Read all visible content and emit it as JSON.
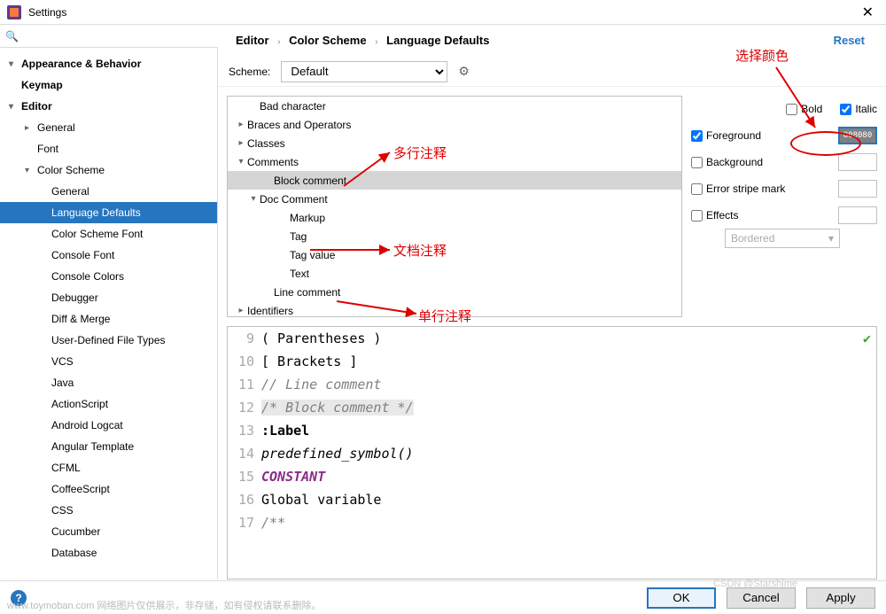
{
  "window": {
    "title": "Settings"
  },
  "breadcrumb": [
    "Editor",
    "Color Scheme",
    "Language Defaults"
  ],
  "reset_label": "Reset",
  "scheme": {
    "label": "Scheme:",
    "value": "Default"
  },
  "sidebar": [
    {
      "label": "Appearance & Behavior",
      "level": 1,
      "chev": "v",
      "bold": true
    },
    {
      "label": "Keymap",
      "level": 1,
      "chev": "",
      "bold": true
    },
    {
      "label": "Editor",
      "level": 1,
      "chev": "v",
      "bold": true
    },
    {
      "label": "General",
      "level": 2,
      "chev": ">",
      "bold": false
    },
    {
      "label": "Font",
      "level": 2,
      "chev": "",
      "bold": false
    },
    {
      "label": "Color Scheme",
      "level": 2,
      "chev": "v",
      "bold": false
    },
    {
      "label": "General",
      "level": 3,
      "chev": "",
      "bold": false
    },
    {
      "label": "Language Defaults",
      "level": 3,
      "chev": "",
      "bold": false,
      "selected": true
    },
    {
      "label": "Color Scheme Font",
      "level": 3,
      "chev": "",
      "bold": false
    },
    {
      "label": "Console Font",
      "level": 3,
      "chev": "",
      "bold": false
    },
    {
      "label": "Console Colors",
      "level": 3,
      "chev": "",
      "bold": false
    },
    {
      "label": "Debugger",
      "level": 3,
      "chev": "",
      "bold": false
    },
    {
      "label": "Diff & Merge",
      "level": 3,
      "chev": "",
      "bold": false
    },
    {
      "label": "User-Defined File Types",
      "level": 3,
      "chev": "",
      "bold": false
    },
    {
      "label": "VCS",
      "level": 3,
      "chev": "",
      "bold": false
    },
    {
      "label": "Java",
      "level": 3,
      "chev": "",
      "bold": false
    },
    {
      "label": "ActionScript",
      "level": 3,
      "chev": "",
      "bold": false
    },
    {
      "label": "Android Logcat",
      "level": 3,
      "chev": "",
      "bold": false
    },
    {
      "label": "Angular Template",
      "level": 3,
      "chev": "",
      "bold": false
    },
    {
      "label": "CFML",
      "level": 3,
      "chev": "",
      "bold": false
    },
    {
      "label": "CoffeeScript",
      "level": 3,
      "chev": "",
      "bold": false
    },
    {
      "label": "CSS",
      "level": 3,
      "chev": "",
      "bold": false
    },
    {
      "label": "Cucumber",
      "level": 3,
      "chev": "",
      "bold": false
    },
    {
      "label": "Database",
      "level": 3,
      "chev": "",
      "bold": false
    }
  ],
  "color_tree": [
    {
      "label": "Bad character",
      "level": 1,
      "chev": ""
    },
    {
      "label": "Braces and Operators",
      "level": 0,
      "chev": ">"
    },
    {
      "label": "Classes",
      "level": 0,
      "chev": ">"
    },
    {
      "label": "Comments",
      "level": 0,
      "chev": "v"
    },
    {
      "label": "Block comment",
      "level": 2,
      "chev": "",
      "selected": true
    },
    {
      "label": "Doc Comment",
      "level": 1,
      "chev": "v"
    },
    {
      "label": "Markup",
      "level": 3,
      "chev": ""
    },
    {
      "label": "Tag",
      "level": 3,
      "chev": ""
    },
    {
      "label": "Tag value",
      "level": 3,
      "chev": ""
    },
    {
      "label": "Text",
      "level": 3,
      "chev": ""
    },
    {
      "label": "Line comment",
      "level": 2,
      "chev": ""
    },
    {
      "label": "Identifiers",
      "level": 0,
      "chev": ">"
    }
  ],
  "options": {
    "bold": {
      "label": "Bold",
      "checked": false
    },
    "italic": {
      "label": "Italic",
      "checked": true
    },
    "foreground": {
      "label": "Foreground",
      "checked": true,
      "color": "808080"
    },
    "background": {
      "label": "Background",
      "checked": false
    },
    "errorstripe": {
      "label": "Error stripe mark",
      "checked": false
    },
    "effects": {
      "label": "Effects",
      "checked": false,
      "type": "Bordered"
    }
  },
  "preview": [
    {
      "n": 9,
      "txt": "( Parentheses )"
    },
    {
      "n": 10,
      "txt": "[ Brackets ]"
    },
    {
      "n": 11,
      "txt": "// Line comment",
      "cls": "italic gray"
    },
    {
      "n": 12,
      "txt": "/* Block comment */",
      "cls": "italic gray blockcm"
    },
    {
      "n": 13,
      "txt": ":Label",
      "cls": "label-kw"
    },
    {
      "n": 14,
      "txt": "predefined_symbol()",
      "cls": "italic"
    },
    {
      "n": 15,
      "txt": "CONSTANT",
      "cls": "constant"
    },
    {
      "n": 16,
      "txt": "Global variable"
    },
    {
      "n": 17,
      "txt": "/**",
      "cls": "italic gray"
    }
  ],
  "buttons": {
    "ok": "OK",
    "cancel": "Cancel",
    "apply": "Apply"
  },
  "annotations": {
    "a1": "多行注释",
    "a2": "文档注释",
    "a3": "单行注释",
    "a4": "选择颜色"
  },
  "watermark": "www.toymoban.com  网络图片仅供展示，非存储，如有侵权请联系删除。",
  "watermark2": "CSDN @Starshime"
}
